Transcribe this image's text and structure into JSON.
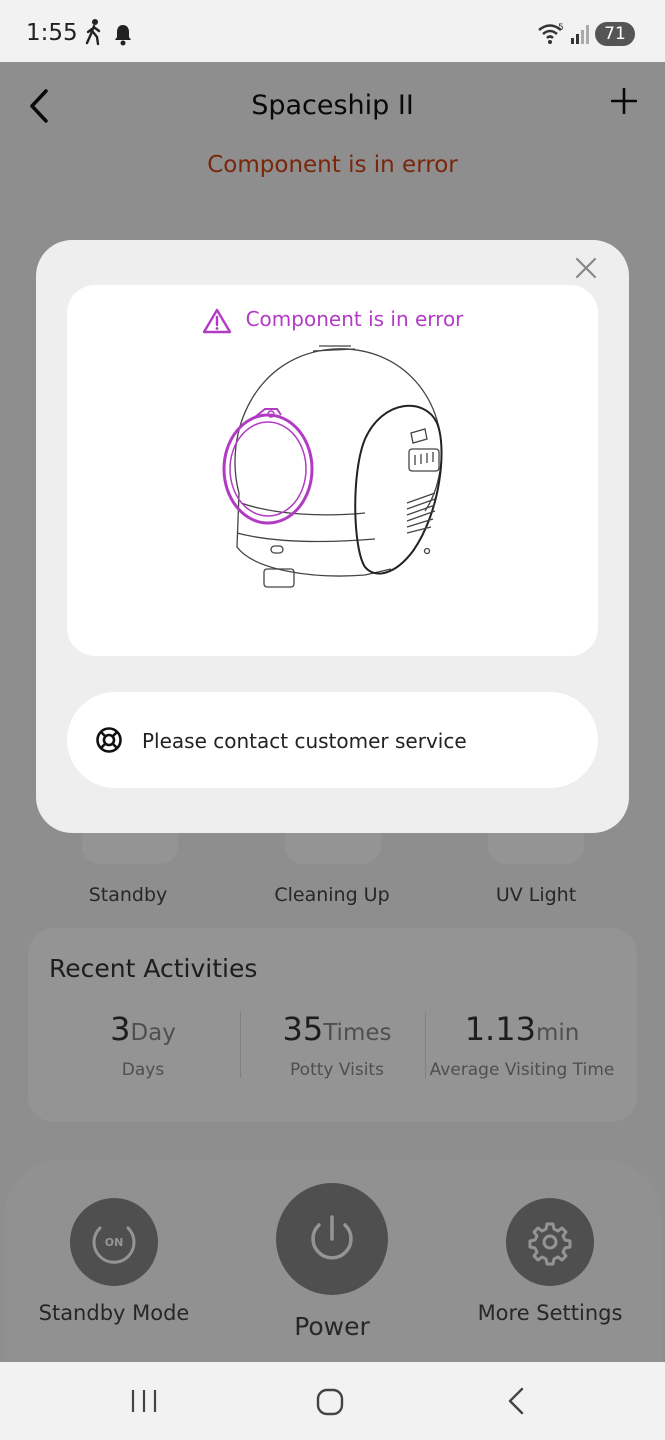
{
  "status_bar": {
    "time": "1:55",
    "battery": "71"
  },
  "header": {
    "title": "Spaceship II",
    "error_text": "Component is in error"
  },
  "modes": [
    {
      "label": "Standby"
    },
    {
      "label": "Cleaning Up"
    },
    {
      "label": "UV Light"
    }
  ],
  "recent": {
    "title": "Recent Activities",
    "stats": [
      {
        "value": "3",
        "unit": "Day",
        "label": "Days"
      },
      {
        "value": "35",
        "unit": "Times",
        "label": "Potty Visits"
      },
      {
        "value": "1.13",
        "unit": "min",
        "label": "Average Visiting Time"
      }
    ]
  },
  "controls": {
    "standby_label": "Standby Mode",
    "standby_badge": "ON",
    "power_label": "Power",
    "settings_label": "More Settings"
  },
  "modal": {
    "error_title": "Component is in error",
    "contact_text": "Please contact customer service"
  },
  "colors": {
    "error_red": "#d14314",
    "error_purple": "#b23bc4",
    "dim": "rgba(0,0,0,0.42)"
  }
}
